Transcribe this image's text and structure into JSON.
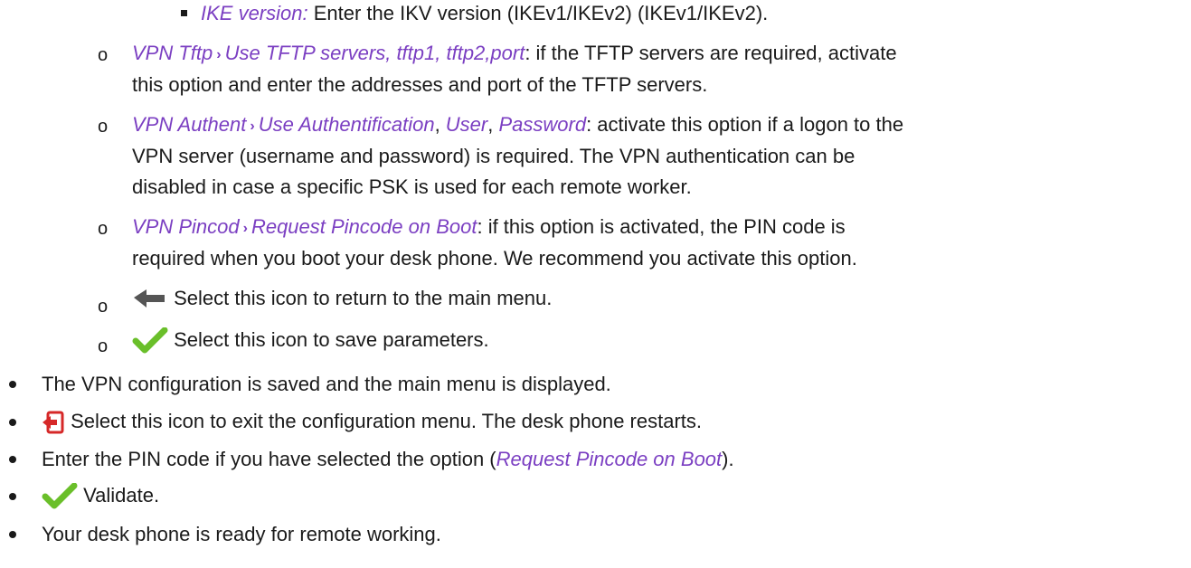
{
  "doc": {
    "ike": {
      "term": "IKE version:",
      "text": " Enter the IKV version (IKEv1/IKEv2) (IKEv1/IKEv2)."
    },
    "tftp": {
      "menu": "VPN Tftp",
      "sep": "›",
      "options": "Use TFTP servers, tftp1, tftp2,port",
      "line1": ": if the TFTP servers are required, activate",
      "line2": "this option and enter the addresses and port of the TFTP servers."
    },
    "authent": {
      "menu": "VPN Authent",
      "sep": "›",
      "opt1": "Use Authentification",
      "comma1": ", ",
      "opt2": "User",
      "comma2": ", ",
      "opt3": "Password",
      "line1": ": activate this option if a logon to the",
      "line2": "VPN server (username and password) is required. The VPN authentication can be",
      "line3": "disabled in case a specific PSK is used for each remote worker."
    },
    "pincod": {
      "menu": "VPN Pincod",
      "sep": "›",
      "option": "Request Pincode on Boot",
      "line1": ": if this option is activated, the PIN code is",
      "line2": "required when you boot your desk phone. We recommend you activate this option."
    },
    "back": {
      "text": "Select this icon to return to the main menu.",
      "icon": "back-arrow-icon"
    },
    "save": {
      "text": "Select this icon to save parameters.",
      "icon": "checkmark-icon"
    },
    "circle_marker": "o",
    "bullets": {
      "saved": "The VPN configuration is saved and the main menu is displayed.",
      "exit": "Select this icon to exit the configuration menu. The desk phone restarts.",
      "pin_pre": "Enter the PIN code if you have selected the option (",
      "pin_option": "Request Pincode on Boot",
      "pin_post": ").",
      "validate": "Validate.",
      "ready": "Your desk phone is ready for remote working."
    },
    "colors": {
      "accent": "#7b3fc2",
      "check": "#6abf2a",
      "exit": "#d62828",
      "arrow": "#555555"
    }
  }
}
